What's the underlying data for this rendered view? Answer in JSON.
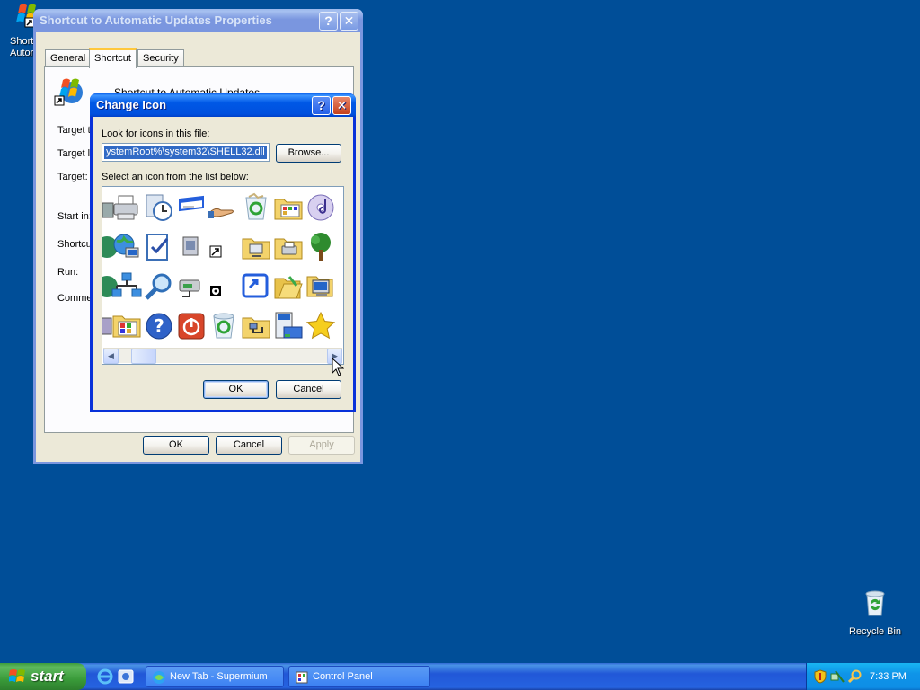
{
  "desktop": {
    "icon_top_left": {
      "line1": "Short",
      "line2": "Autor"
    },
    "recycle_bin": {
      "label": "Recycle Bin"
    }
  },
  "properties": {
    "title": "Shortcut to Automatic Updates Properties",
    "tabs": [
      "General",
      "Shortcut",
      "Security"
    ],
    "active_tab": "Shortcut",
    "name": "Shortcut to Automatic Updates",
    "labels": {
      "target_type": "Target ty",
      "target_location": "Target lo",
      "target": "Target:",
      "start_in": "Start in:",
      "shortcut_key": "Shortcu",
      "run": "Run:",
      "comment": "Commer"
    },
    "buttons": {
      "ok": "OK",
      "cancel": "Cancel",
      "apply": "Apply"
    }
  },
  "change_icon": {
    "title": "Change Icon",
    "look_label": "Look for icons in this file:",
    "file_value": "ystemRoot%\\system32\\SHELL32.dll",
    "browse": "Browse...",
    "list_label": "Select an icon from the list below:",
    "icons": [
      [
        "partial",
        "printer-icon",
        "scheduled-tasks-icon",
        "window-icon",
        "share-hand-icon",
        "recycle-bin-full-icon",
        "control-panel-folder-icon",
        "cd-audio-icon"
      ],
      [
        "partial",
        "network-globe-icon",
        "task-check-icon",
        "speaker-box-icon",
        "shortcut-arrow-icon",
        "shared-folder-icon",
        "printer-folder-icon",
        "tree-icon"
      ],
      [
        "partial",
        "network-icon",
        "search-icon",
        "drive-network-icon",
        "cd-small-icon",
        "move-window-icon",
        "open-folder-icon",
        "computer-icon"
      ],
      [
        "partial",
        "control-panel-icon",
        "help-icon",
        "shutdown-icon",
        "recycle-bin-icon",
        "network-folder-icon",
        "taskbar-settings-icon",
        "favorites-star-icon"
      ]
    ],
    "buttons": {
      "ok": "OK",
      "cancel": "Cancel"
    }
  },
  "taskbar": {
    "start": "start",
    "items": [
      {
        "label": "New Tab - Supermium",
        "icon": "browser-icon"
      },
      {
        "label": "Control Panel",
        "icon": "control-panel-icon"
      }
    ],
    "clock": "7:33 PM"
  }
}
